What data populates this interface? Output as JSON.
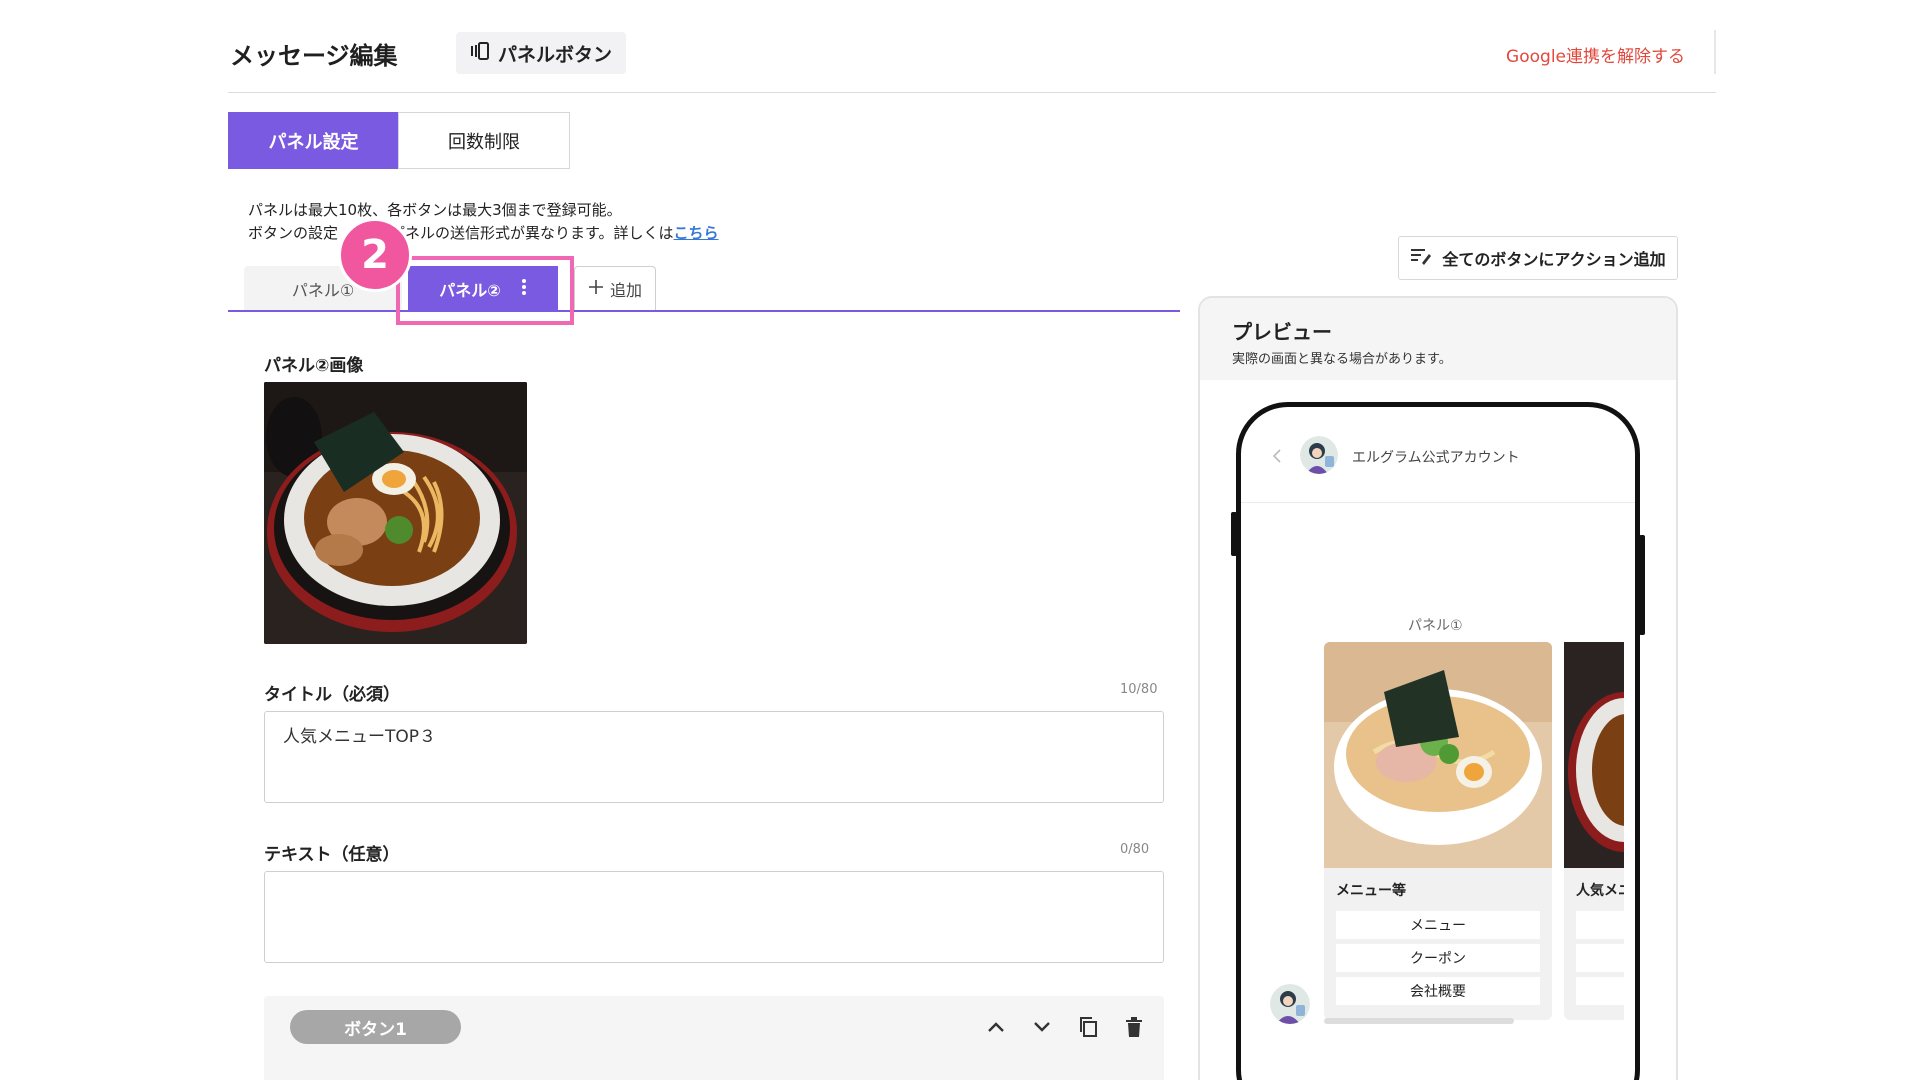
{
  "header": {
    "title": "メッセージ編集",
    "type_badge": "パネルボタン",
    "type_icon": "panel-carousel-icon",
    "google_unlink": "Google連携を解除する"
  },
  "settings_tabs": {
    "active": "パネル設定",
    "inactive": "回数制限"
  },
  "info": {
    "line1": "パネルは最大10枚、各ボタンは最大3個まで登録可能。",
    "line2_prefix": "ボタンの設定",
    "line2_middle": "パネルの送信形式が異なります。詳しくは",
    "line2_link": "こちら"
  },
  "step_badge": "2",
  "panel_tabs": {
    "tab1": "パネル①",
    "tab2": "パネル②",
    "add": "追加"
  },
  "form": {
    "image_label": "パネル②画像",
    "title_label": "タイトル（必須）",
    "title_count": "10/80",
    "title_value": "人気メニューTOP３",
    "text_label": "テキスト（任意）",
    "text_count": "0/80",
    "button_label": "ボタン1"
  },
  "preview": {
    "add_action": "全てのボタンにアクション追加",
    "title": "プレビュー",
    "subtitle": "実際の画面と異なる場合があります。",
    "account_name": "エルグラム公式アカウント",
    "carousel_label": "パネル①",
    "card1": {
      "title": "メニュー等",
      "buttons": [
        "メニュー",
        "クーポン",
        "会社概要"
      ]
    },
    "card2": {
      "title": "人気メニ"
    }
  },
  "colors": {
    "accent": "#7a5ae0",
    "highlight": "#f067b4",
    "link": "#3577d8",
    "danger": "#e2483d"
  }
}
